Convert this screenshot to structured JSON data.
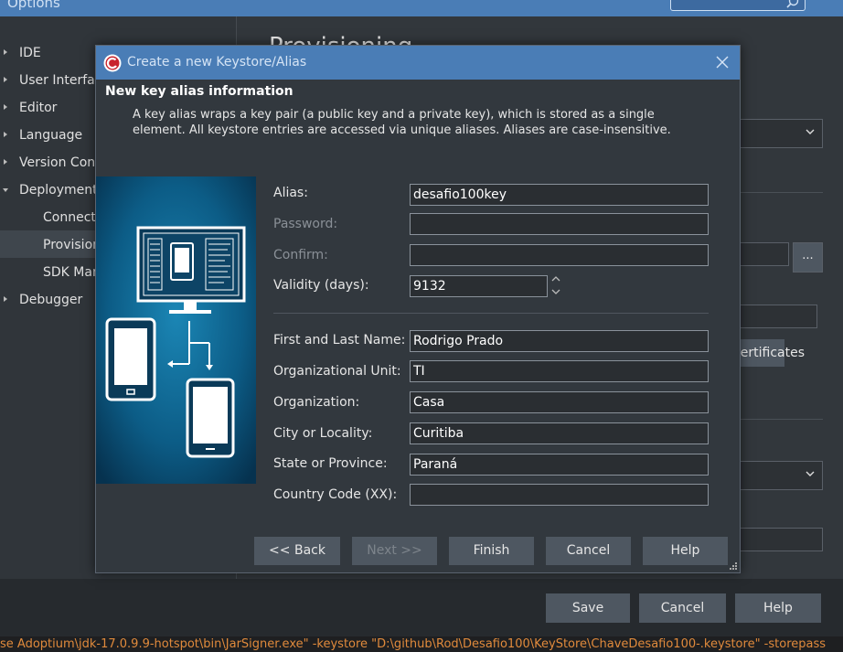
{
  "background_window": {
    "title": "Options",
    "heading": "Provisioning",
    "tree": [
      {
        "label": "IDE",
        "expandable": true
      },
      {
        "label": "User Interface",
        "expandable": true
      },
      {
        "label": "Editor",
        "expandable": true
      },
      {
        "label": "Language",
        "expandable": true
      },
      {
        "label": "Version Control",
        "expandable": true
      },
      {
        "label": "Deployment",
        "expandable": true,
        "expanded": true
      },
      {
        "label": "Connection",
        "child": true
      },
      {
        "label": "Provisioning",
        "child": true,
        "selected": true
      },
      {
        "label": "SDK Manager",
        "child": true
      },
      {
        "label": "Debugger",
        "expandable": true
      }
    ],
    "browse_button": "...",
    "certificates_button": "Certificates",
    "footer": {
      "save": "Save",
      "cancel": "Cancel",
      "help": "Help"
    },
    "console_line": "se Adoptium\\jdk-17.0.9.9-hotspot\\bin\\JarSigner.exe\" -keystore \"D:\\github\\Rod\\Desafio100\\KeyStore\\ChaveDesafio100-.keystore\" -storepass"
  },
  "dialog": {
    "title": "Create a new Keystore/Alias",
    "header_title": "New key alias information",
    "header_description": "A key alias wraps a key pair (a public key and a private key), which is stored as a single element. All keystore entries are accessed via unique aliases. Aliases are case-insensitive.",
    "fields": {
      "alias": {
        "label": "Alias:",
        "value": "desafio100key"
      },
      "password": {
        "label": "Password:",
        "value": ""
      },
      "confirm": {
        "label": "Confirm:",
        "value": ""
      },
      "validity": {
        "label": "Validity (days):",
        "value": "9132"
      },
      "name": {
        "label": "First and Last Name:",
        "value": "Rodrigo Prado"
      },
      "org_unit": {
        "label": "Organizational Unit:",
        "value": "TI"
      },
      "organization": {
        "label": "Organization:",
        "value": "Casa"
      },
      "city": {
        "label": "City or Locality:",
        "value": "Curitiba"
      },
      "state": {
        "label": "State or Province:",
        "value": "Paraná"
      },
      "country": {
        "label": "Country Code (XX):",
        "value": ""
      }
    },
    "buttons": {
      "back": "<< Back",
      "next": "Next >>",
      "finish": "Finish",
      "cancel": "Cancel",
      "help": "Help"
    }
  },
  "colors": {
    "title_bar": "#4a7db6",
    "panel": "#32383e",
    "button": "#4e5761",
    "console_text": "#e08a3c"
  }
}
